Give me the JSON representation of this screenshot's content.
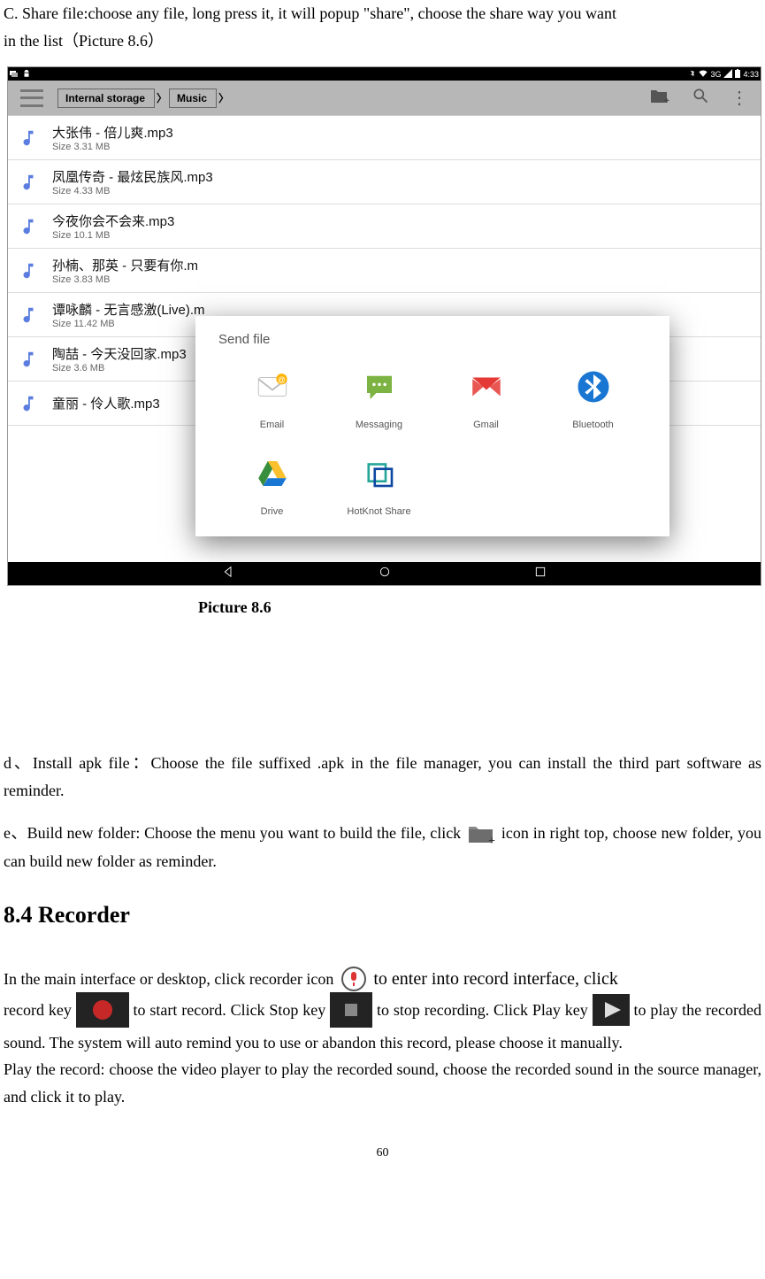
{
  "doc": {
    "intro_line1": "C. Share file:choose any file, long press it, it will popup \"share\", choose the share way you want",
    "intro_line2": "in the list（Picture 8.6）",
    "caption": "Picture 8.6",
    "para_d": "d、Install apk file：Choose the file suffixed .apk in the file manager, you can install the third part software as reminder.",
    "para_e_pre": "e、Build new folder: Choose the menu you want to build the file, click ",
    "para_e_post": " icon in right top, choose new folder, you can build new folder as reminder.",
    "heading": "8.4  Recorder",
    "rec_1": "In the main interface or desktop, click recorder icon ",
    "rec_2": " to enter into record interface, click",
    "rec_3": "record key ",
    "rec_4": " to start record. Click Stop key ",
    "rec_5": " to stop recording. Click Play key ",
    "rec_6": " to play the recorded sound. The system will auto remind you to use or abandon this record, please choose it manually.",
    "rec_play": "Play the record: choose the video player to play the recorded sound, choose the recorded sound in the source manager, and click it to play.",
    "page_number": "60"
  },
  "statusbar": {
    "time": "4:33",
    "signal": "3G"
  },
  "breadcrumb": {
    "a": "Internal storage",
    "b": "Music"
  },
  "files": [
    {
      "name": "大张伟 - 倍儿爽.mp3",
      "size": "Size 3.31 MB"
    },
    {
      "name": "凤凰传奇 - 最炫民族风.mp3",
      "size": "Size 4.33 MB"
    },
    {
      "name": "今夜你会不会来.mp3",
      "size": "Size 10.1 MB"
    },
    {
      "name": "孙楠、那英 - 只要有你.m",
      "size": "Size 3.83 MB"
    },
    {
      "name": "谭咏麟 - 无言感激(Live).m",
      "size": "Size 11.42 MB"
    },
    {
      "name": "陶喆 - 今天没回家.mp3",
      "size": "Size 3.6 MB"
    },
    {
      "name": "童丽 - 伶人歌.mp3",
      "size": ""
    }
  ],
  "dialog": {
    "title": "Send file",
    "options": [
      {
        "label": "Email"
      },
      {
        "label": "Messaging"
      },
      {
        "label": "Gmail"
      },
      {
        "label": "Bluetooth"
      },
      {
        "label": "Drive"
      },
      {
        "label": "HotKnot Share"
      }
    ]
  }
}
